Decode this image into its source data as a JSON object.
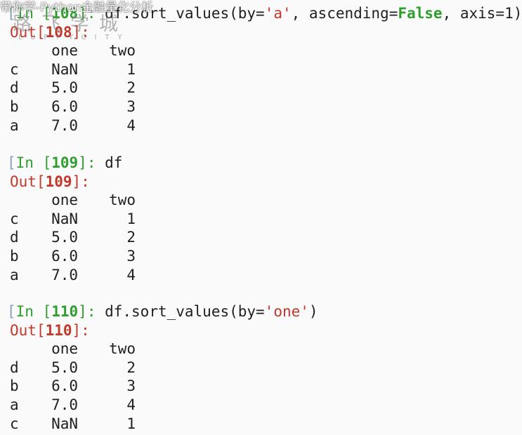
{
  "watermark": {
    "top_text": "带你学-Python金融量化分析",
    "cn": "路飞学城",
    "en": "LUFFYCITY"
  },
  "cells": [
    {
      "in_label": "In [",
      "in_num": "108",
      "in_close": "]:",
      "code_prefix": " df.sort_values(by=",
      "code_str": "'a'",
      "code_mid": ", ascending=",
      "code_kw": "False",
      "code_suffix": ", axis=1)",
      "out_label": "Out[",
      "out_num": "108",
      "out_close": "]:",
      "columns": [
        "one",
        "two"
      ],
      "rows": [
        {
          "idx": "c",
          "one": "NaN",
          "two": "1"
        },
        {
          "idx": "d",
          "one": "5.0",
          "two": "2"
        },
        {
          "idx": "b",
          "one": "6.0",
          "two": "3"
        },
        {
          "idx": "a",
          "one": "7.0",
          "two": "4"
        }
      ]
    },
    {
      "in_label": "In [",
      "in_num": "109",
      "in_close": "]:",
      "code_prefix": " df",
      "code_str": "",
      "code_mid": "",
      "code_kw": "",
      "code_suffix": "",
      "out_label": "Out[",
      "out_num": "109",
      "out_close": "]:",
      "columns": [
        "one",
        "two"
      ],
      "rows": [
        {
          "idx": "c",
          "one": "NaN",
          "two": "1"
        },
        {
          "idx": "d",
          "one": "5.0",
          "two": "2"
        },
        {
          "idx": "b",
          "one": "6.0",
          "two": "3"
        },
        {
          "idx": "a",
          "one": "7.0",
          "two": "4"
        }
      ]
    },
    {
      "in_label": "In [",
      "in_num": "110",
      "in_close": "]:",
      "code_prefix": " df.sort_values(by=",
      "code_str": "'one'",
      "code_mid": ")",
      "code_kw": "",
      "code_suffix": "",
      "out_label": "Out[",
      "out_num": "110",
      "out_close": "]:",
      "columns": [
        "one",
        "two"
      ],
      "rows": [
        {
          "idx": "d",
          "one": "5.0",
          "two": "2"
        },
        {
          "idx": "b",
          "one": "6.0",
          "two": "3"
        },
        {
          "idx": "a",
          "one": "7.0",
          "two": "4"
        },
        {
          "idx": "c",
          "one": "NaN",
          "two": "1"
        }
      ]
    }
  ]
}
